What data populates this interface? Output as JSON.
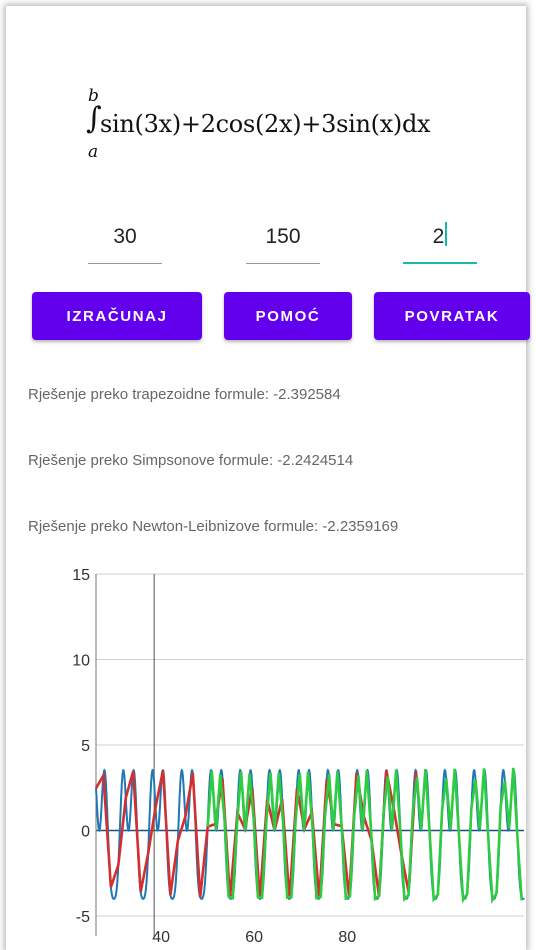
{
  "formula": {
    "upper": "b",
    "lower": "a",
    "expression": "sin(3x)+2cos(2x)+3sin(x)dx"
  },
  "inputs": [
    {
      "value": "30"
    },
    {
      "value": "150"
    },
    {
      "value": "2"
    }
  ],
  "buttons": {
    "calculate": "IZRAČUNAJ",
    "help": "POMOĆ",
    "back": "POVRATAK"
  },
  "results": {
    "trapezoid": "Rješenje preko trapezoidne formule: -2.392584",
    "simpson": "Rješenje preko Simpsonove formule: -2.2424514",
    "newton_leibniz": "Rješenje preko Newton-Leibnizove formule: -2.2359169"
  },
  "colors": {
    "accent": "#6200ee",
    "cursor": "#17b8b0",
    "series_exact": "#1f77b4",
    "series_trapezoid": "#d32f2f",
    "series_simpson": "#2ecc40"
  },
  "chart_data": {
    "type": "line",
    "xlim": [
      26,
      118
    ],
    "ylim": [
      -5,
      15
    ],
    "xticks": [
      40,
      60,
      80
    ],
    "yticks": [
      -5,
      0,
      5,
      10,
      15
    ],
    "grid": "horizontal",
    "series": [
      {
        "color": "#1f77b4",
        "x_range": [
          26,
          118
        ],
        "function": "sin(3x)+2cos(2x)+3sin(x)"
      },
      {
        "color": "#d32f2f",
        "x_range": [
          26,
          96
        ]
      },
      {
        "color": "#2ecc40",
        "x_range": [
          50,
          118
        ]
      }
    ]
  }
}
